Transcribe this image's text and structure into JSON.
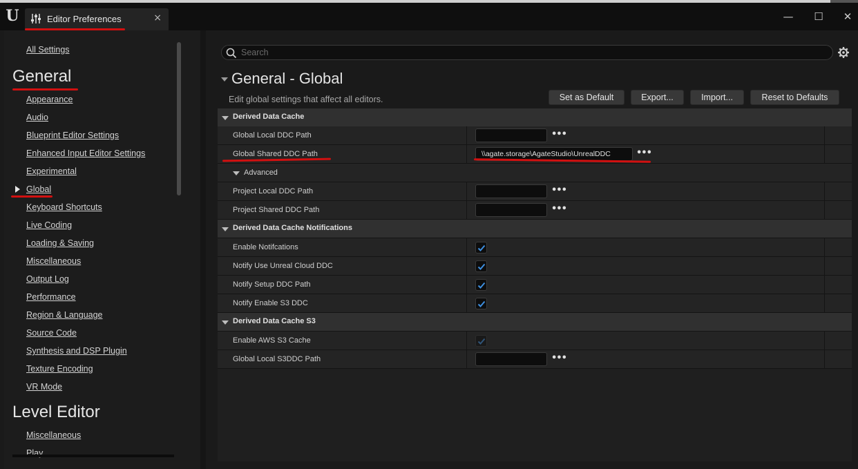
{
  "window": {
    "logo": "U",
    "tab_title": "Editor Preferences",
    "close_glyph": "×",
    "minimize_glyph": "—",
    "maximize_glyph": "☐",
    "window_close_glyph": "✕"
  },
  "sidebar": {
    "top_link": "All Settings",
    "sections": [
      {
        "heading": "General",
        "items": [
          "Appearance",
          "Audio",
          "Blueprint Editor Settings",
          "Enhanced Input Editor Settings",
          "Experimental",
          "Global",
          "Keyboard Shortcuts",
          "Live Coding",
          "Loading & Saving",
          "Miscellaneous",
          "Output Log",
          "Performance",
          "Region & Language",
          "Source Code",
          "Synthesis and DSP Plugin",
          "Texture Encoding",
          "VR Mode"
        ],
        "selected": "Global"
      },
      {
        "heading": "Level Editor",
        "items": [
          "Miscellaneous",
          "Play"
        ]
      }
    ]
  },
  "search": {
    "placeholder": "Search",
    "value": ""
  },
  "main": {
    "title": "General - Global",
    "description": "Edit global settings that affect all editors.",
    "buttons": {
      "set_default": "Set as Default",
      "export": "Export...",
      "import": "Import...",
      "reset": "Reset to Defaults"
    }
  },
  "grid": {
    "ddc": {
      "category": "Derived Data Cache",
      "global_local_ddc_path": {
        "label": "Global Local DDC Path",
        "value": ""
      },
      "global_shared_ddc_path": {
        "label": "Global Shared DDC Path",
        "value": "\\\\agate.storage\\AgateStudio\\UnrealDDC"
      },
      "advanced_label": "Advanced",
      "project_local_ddc_path": {
        "label": "Project Local DDC Path",
        "value": ""
      },
      "project_shared_ddc_path": {
        "label": "Project Shared DDC Path",
        "value": ""
      }
    },
    "notifications": {
      "category": "Derived Data Cache Notifications",
      "enable_notifications": {
        "label": "Enable Notifcations",
        "checked": true
      },
      "notify_unreal_cloud": {
        "label": "Notify Use Unreal Cloud DDC",
        "checked": true
      },
      "notify_setup_path": {
        "label": "Notify Setup DDC Path",
        "checked": true
      },
      "notify_s3": {
        "label": "Notify Enable S3 DDC",
        "checked": true
      }
    },
    "s3": {
      "category": "Derived Data Cache S3",
      "enable_aws": {
        "label": "Enable AWS S3 Cache",
        "checked": true,
        "disabled": true
      },
      "global_local_s3ddc_path": {
        "label": "Global Local S3DDC Path",
        "value": ""
      }
    },
    "browse_glyph": "•••"
  },
  "colors": {
    "background": "#151515",
    "panel": "#1a1a1a",
    "checkbox_accent": "#3d8fe0",
    "annotation_red": "#d21010"
  }
}
